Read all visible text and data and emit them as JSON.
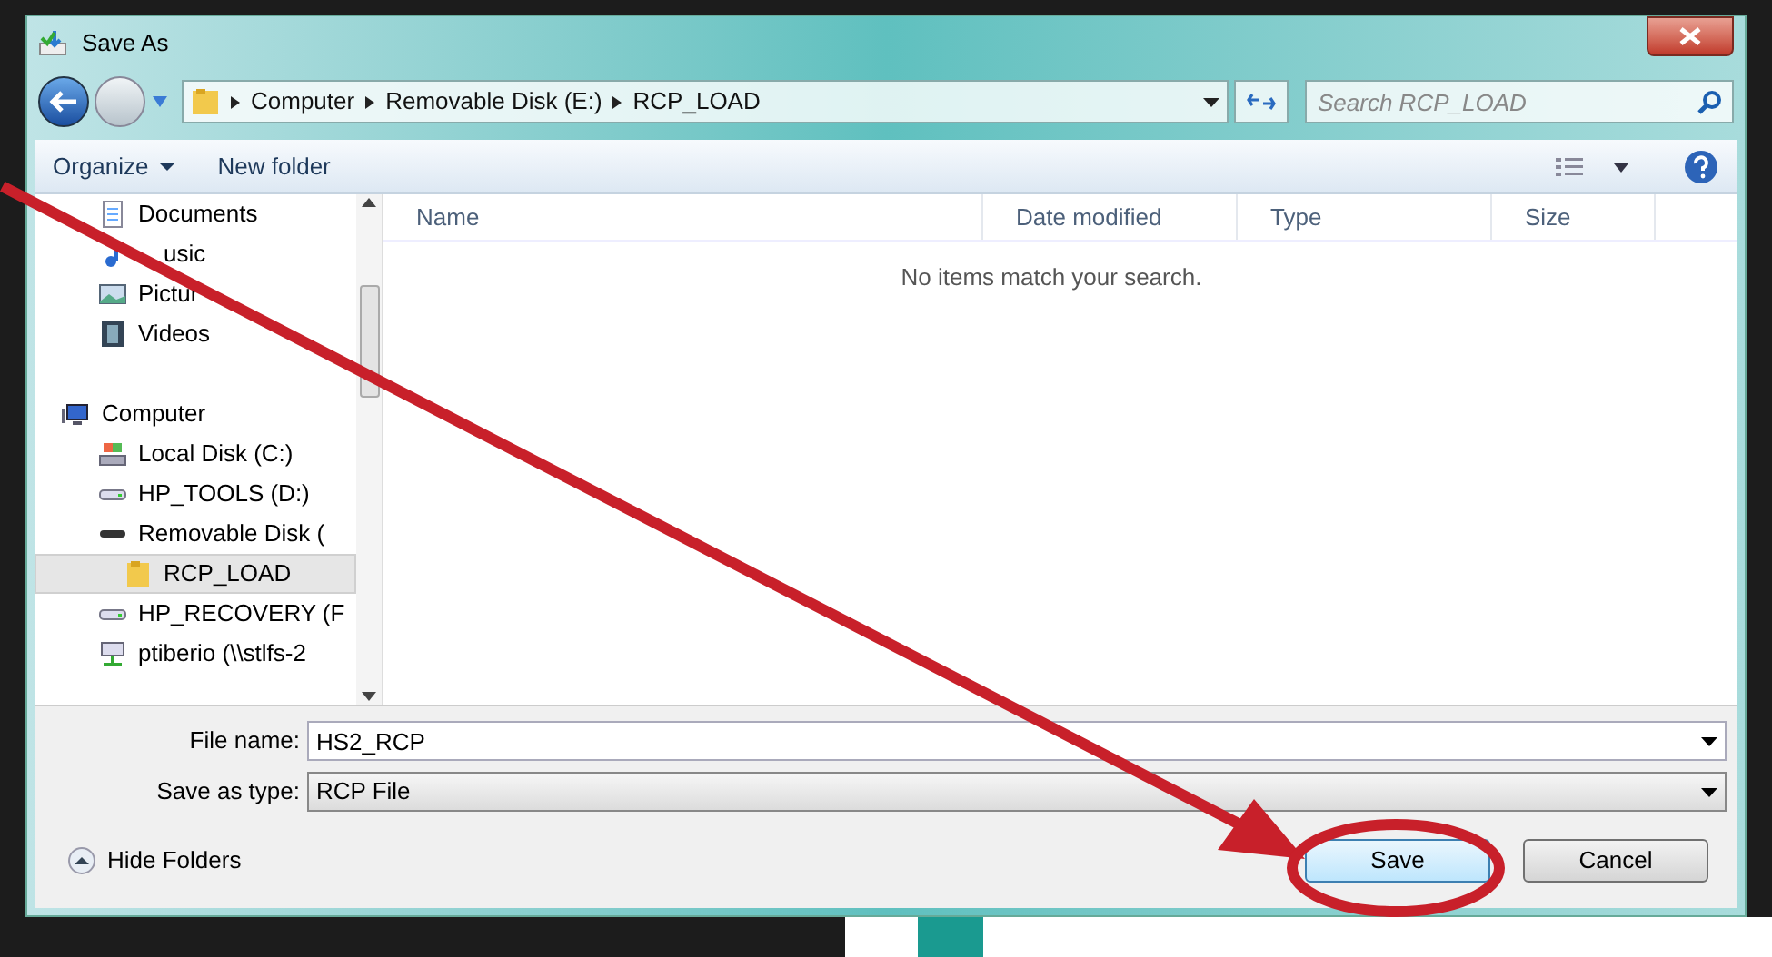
{
  "window": {
    "title": "Save As"
  },
  "address_bar": {
    "segments": [
      "Computer",
      "Removable Disk (E:)",
      "RCP_LOAD"
    ]
  },
  "search": {
    "placeholder": "Search RCP_LOAD"
  },
  "toolbar": {
    "buttons": [
      {
        "label": "Organize",
        "dropdown": true
      },
      {
        "label": "New folder",
        "dropdown": false
      }
    ]
  },
  "sidebar": {
    "items": [
      {
        "label": "Documents",
        "kind": "document",
        "selected": false
      },
      {
        "label": "usic",
        "kind": "music",
        "selected": false
      },
      {
        "label": "Pictur",
        "kind": "picture",
        "selected": false
      },
      {
        "label": "Videos",
        "kind": "video",
        "selected": false
      },
      {
        "label": "Computer",
        "kind": "computer",
        "selected": false
      },
      {
        "label": "Local Disk (C:)",
        "kind": "system",
        "selected": false
      },
      {
        "label": "HP_TOOLS (D:)",
        "kind": "drive",
        "selected": false
      },
      {
        "label": "Removable Disk (",
        "kind": "removable",
        "selected": false
      },
      {
        "label": "RCP_LOAD",
        "kind": "folder",
        "selected": true
      },
      {
        "label": "HP_RECOVERY (F",
        "kind": "drive",
        "selected": false
      },
      {
        "label": "ptiberio (\\\\stlfs-2",
        "kind": "network",
        "selected": false
      }
    ]
  },
  "file_list": {
    "columns": [
      "Name",
      "Date modified",
      "Type",
      "Size"
    ],
    "empty_message": "No items match your search."
  },
  "form": {
    "file_name": {
      "label": "File name:",
      "value": "HS2_RCP"
    },
    "save_as_type": {
      "label": "Save as type:",
      "value": "RCP File"
    }
  },
  "footer": {
    "hide_folders": "Hide Folders",
    "buttons": [
      {
        "label": "Save",
        "primary": true
      },
      {
        "label": "Cancel",
        "primary": false
      }
    ]
  }
}
